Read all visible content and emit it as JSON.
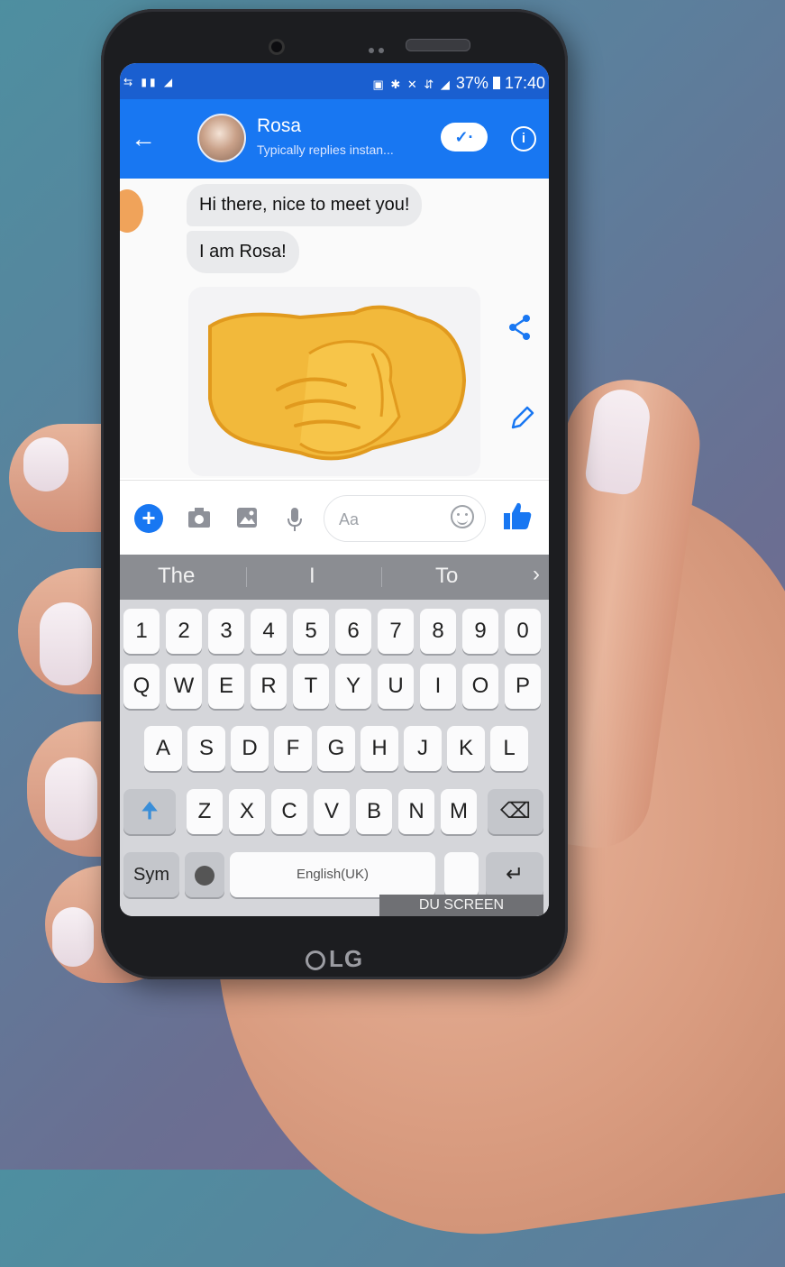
{
  "status_bar": {
    "time": "17:40",
    "battery": "37%",
    "left_icons": "⇆ ▮▮ ◢",
    "right_icons": "▣ ✱ ✕ ⇵ ◢"
  },
  "header": {
    "back_icon": "arrow-left-icon",
    "contact_name": "Rosa",
    "contact_status": "Typically replies instan...",
    "check_icon": "✓·",
    "info_icon": "i"
  },
  "messages": [
    {
      "text": "Hi there, nice to meet you!"
    },
    {
      "text": "I am Rosa!"
    }
  ],
  "sticker": {
    "icon": "handshake-icon"
  },
  "composer": {
    "add_icon": "+",
    "placeholder": "Aa"
  },
  "suggestions": {
    "words": [
      "The",
      "I",
      "To"
    ],
    "next": "›"
  },
  "keyboard": {
    "row_numbers": [
      "1",
      "2",
      "3",
      "4",
      "5",
      "6",
      "7",
      "8",
      "9",
      "0"
    ],
    "row_q": [
      "Q",
      "W",
      "E",
      "R",
      "T",
      "Y",
      "U",
      "I",
      "O",
      "P"
    ],
    "row_a": [
      "A",
      "S",
      "D",
      "F",
      "G",
      "H",
      "J",
      "K",
      "L"
    ],
    "row_z": [
      "Z",
      "X",
      "C",
      "V",
      "B",
      "N",
      "M"
    ],
    "shift_icon": "🠉",
    "backspace_icon": "⌫",
    "sym_label": "Sym",
    "space_label": "English(UK)",
    "enter_icon": "↵"
  },
  "recorder_label": "DU SCREEN RECORDER",
  "phone_brand": "LG",
  "colors": {
    "messenger_blue": "#1877f2",
    "status_bar_blue": "#1a5fd0",
    "bubble_grey": "#e9eaec"
  }
}
